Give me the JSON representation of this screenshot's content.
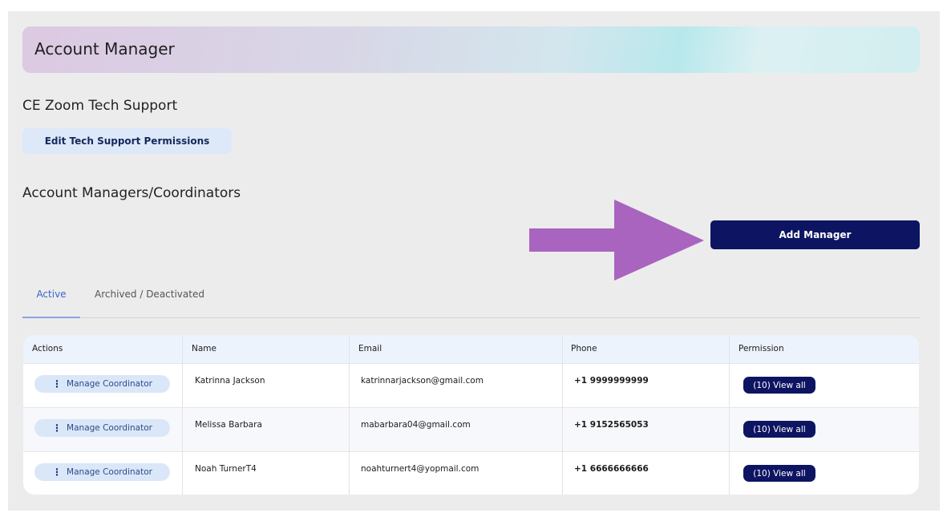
{
  "banner": {
    "title": "Account Manager"
  },
  "tech_support": {
    "title": "CE Zoom Tech Support",
    "edit_button": "Edit Tech Support Permissions"
  },
  "managers": {
    "title": "Account Managers/Coordinators",
    "add_button": "Add Manager"
  },
  "tabs": {
    "active": "Active",
    "archived": "Archived / Deactivated"
  },
  "table": {
    "headers": [
      "Actions",
      "Name",
      "Email",
      "Phone",
      "Permission"
    ],
    "rows": [
      {
        "action": "Manage Coordinator",
        "name": "Katrinna Jackson",
        "email": "katrinnarjackson@gmail.com",
        "phone": "+1 9999999999",
        "permission": "(10) View all"
      },
      {
        "action": "Manage Coordinator",
        "name": "Melissa Barbara",
        "email": "mabarbara04@gmail.com",
        "phone": "+1 9152565053",
        "permission": "(10) View all"
      },
      {
        "action": "Manage Coordinator",
        "name": "Noah TurnerT4",
        "email": "noahturnert4@yopmail.com",
        "phone": "+1 6666666666",
        "permission": "(10) View all"
      }
    ]
  },
  "icons": {
    "row_menu": "vertical-ellipsis-icon",
    "pointer": "right-arrow-icon"
  },
  "colors": {
    "primary": "#0d1562",
    "arrow": "#a864bf",
    "tab_active": "#3e63cc",
    "light_button": "#dde9f9"
  }
}
